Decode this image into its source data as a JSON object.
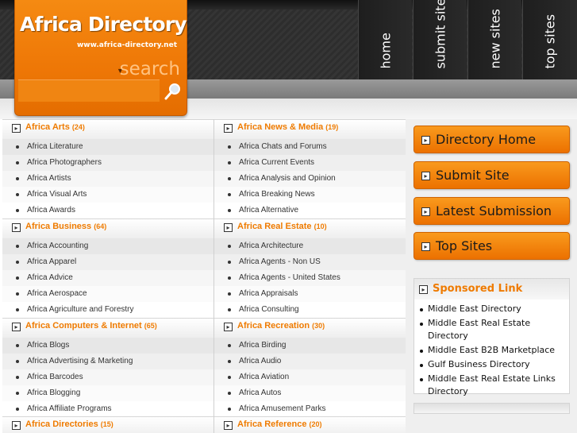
{
  "header": {
    "logo_title": "Africa Directory",
    "logo_url": "www.africa-directory.net",
    "search_label": "search",
    "search_icon": "magnifier-icon",
    "nav": [
      {
        "label": "home"
      },
      {
        "label": "submit site"
      },
      {
        "label": "new sites"
      },
      {
        "label": "top sites"
      }
    ]
  },
  "categories": [
    {
      "name": "Africa Arts",
      "count": "(24)",
      "items": [
        "Africa Literature",
        "Africa Photographers",
        "Africa Artists",
        "Africa Visual Arts",
        "Africa Awards"
      ]
    },
    {
      "name": "Africa News & Media",
      "count": "(19)",
      "items": [
        "Africa Chats and Forums",
        "Africa Current Events",
        "Africa Analysis and Opinion",
        "Africa Breaking News",
        "Africa Alternative"
      ]
    },
    {
      "name": "Africa Business",
      "count": "(64)",
      "items": [
        "Africa Accounting",
        "Africa Apparel",
        "Africa Advice",
        "Africa Aerospace",
        "Africa Agriculture and Forestry"
      ]
    },
    {
      "name": "Africa Real Estate",
      "count": "(10)",
      "items": [
        "Africa Architecture",
        "Africa Agents - Non US",
        "Africa Agents - United States",
        "Africa Appraisals",
        "Africa Consulting"
      ]
    },
    {
      "name": "Africa Computers & Internet",
      "count": "(65)",
      "items": [
        "Africa Blogs",
        "Africa Advertising & Marketing",
        "Africa Barcodes",
        "Africa Blogging",
        "Africa Affiliate Programs"
      ]
    },
    {
      "name": "Africa Recreation",
      "count": "(30)",
      "items": [
        "Africa Birding",
        "Africa Audio",
        "Africa Aviation",
        "Africa Autos",
        "Africa Amusement Parks"
      ]
    },
    {
      "name": "Africa Directories",
      "count": "(15)",
      "items": []
    },
    {
      "name": "Africa Reference",
      "count": "(20)",
      "items": []
    }
  ],
  "sidebar": {
    "buttons": [
      {
        "label": "Directory Home"
      },
      {
        "label": "Submit Site"
      },
      {
        "label": "Latest Submission"
      },
      {
        "label": "Top Sites"
      }
    ],
    "sponsored": {
      "title": "Sponsored Link",
      "links": [
        "Middle East Directory",
        "Middle East Real Estate Directory",
        "Middle East B2B Marketplace",
        "Gulf Business Directory",
        "Middle East Real Estate Links Directory"
      ]
    }
  },
  "colors": {
    "accent": "#ef7b00",
    "header_dark": "#2d2d2d"
  }
}
